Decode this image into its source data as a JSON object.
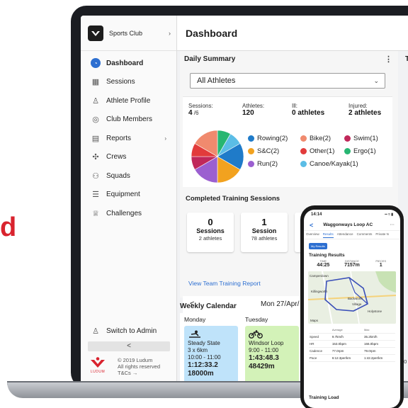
{
  "partial_left_letter": "d",
  "sidebar": {
    "club_name": "Sports Club",
    "items": [
      {
        "label": "Dashboard"
      },
      {
        "label": "Sessions"
      },
      {
        "label": "Athlete Profile"
      },
      {
        "label": "Club Members"
      },
      {
        "label": "Reports"
      },
      {
        "label": "Crews"
      },
      {
        "label": "Squads"
      },
      {
        "label": "Equipment"
      },
      {
        "label": "Challenges"
      }
    ],
    "switch_admin": "Switch to Admin",
    "collapse_glyph": "<",
    "footer": {
      "copyright": "© 2019 Ludum",
      "rights": "All rights reserved",
      "terms": "T&Cs →",
      "logo_text": "LUDUM"
    }
  },
  "header": {
    "title": "Dashboard"
  },
  "daily_summary": {
    "title": "Daily Summary",
    "right_panel_letter": "T",
    "select_value": "All Athletes",
    "stats": [
      {
        "label": "Sessions:",
        "value": "4",
        "suffix": " /6"
      },
      {
        "label": "Athletes:",
        "value": "120",
        "suffix": ""
      },
      {
        "label": "Ill:",
        "value": "0 athletes",
        "suffix": ""
      },
      {
        "label": "Injured:",
        "value": "2 athletes",
        "suffix": ""
      }
    ],
    "legend": [
      {
        "label": "Rowing(2)",
        "color": "#1f7bc9"
      },
      {
        "label": "Bike(2)",
        "color": "#f08a6e"
      },
      {
        "label": "Swim(1)",
        "color": "#c0285a"
      },
      {
        "label": "S&C(2)",
        "color": "#f2a21f"
      },
      {
        "label": "Other(1)",
        "color": "#e23b3b"
      },
      {
        "label": "Ergo(1)",
        "color": "#27b672"
      },
      {
        "label": "Run(2)",
        "color": "#9b5fd0"
      },
      {
        "label": "Canoe/Kayak(1)",
        "color": "#5bbde6"
      }
    ]
  },
  "completed": {
    "title": "Completed Training Sessions",
    "cards": [
      {
        "number": "0",
        "label": "Sessions",
        "sub": "2 athletes"
      },
      {
        "number": "1",
        "label": "Session",
        "sub": "78 athletes"
      }
    ],
    "report_link": "View Team Training Report",
    "date_prev": "<",
    "date_text": "Mon 27/Apr/"
  },
  "weekly": {
    "title": "Weekly Calendar",
    "days": [
      "Monday",
      "Tuesday"
    ],
    "events": [
      {
        "title": "Steady State",
        "detail": "3 x 6km",
        "time_range": "10:00 - 11:00",
        "duration": "1:12:33.2",
        "distance": "18000m",
        "icon": "rowing-icon"
      },
      {
        "title": "Windsor Loop",
        "detail": "9:00 - 11:00",
        "time_range": "",
        "duration": "1:43:48.3",
        "distance": "48429m",
        "icon": "bike-icon"
      }
    ]
  },
  "edge_fragments": {
    "a": "n",
    "b": "ff",
    "c": "30"
  },
  "phone": {
    "time": "14:14",
    "status_right": "▪▪ ≈ ▮",
    "back": "<",
    "club": "Waggonways Loop AC",
    "more": "···",
    "tabs": [
      "Overview",
      "Results",
      "Attendance",
      "Comments",
      "Private N"
    ],
    "chip": "My Results",
    "section": "Training Results",
    "metrics": [
      {
        "label": "TIME",
        "value": "44:25"
      },
      {
        "label": "DISTANCE",
        "value": "7157m"
      },
      {
        "label": "PIECES",
        "value": "1"
      }
    ],
    "map_label": "Maps",
    "map_places": [
      "Camperdown",
      "Killingworth",
      "Backworth",
      "Holystone",
      "Village"
    ],
    "table_headers": [
      "",
      "Average",
      "Max"
    ],
    "table_rows": [
      {
        "label": "Speed",
        "avg": "9.7km/h",
        "max": "35.2km/h"
      },
      {
        "label": "HR",
        "avg": "153.0bpm",
        "max": "166.0bpm"
      },
      {
        "label": "Cadence",
        "avg": "77.0rpm",
        "max": "79.0rpm"
      },
      {
        "label": "Pace",
        "avg": "6:12.3per/km",
        "max": "1:42.2per/km"
      }
    ],
    "load_title": "Training Load"
  }
}
